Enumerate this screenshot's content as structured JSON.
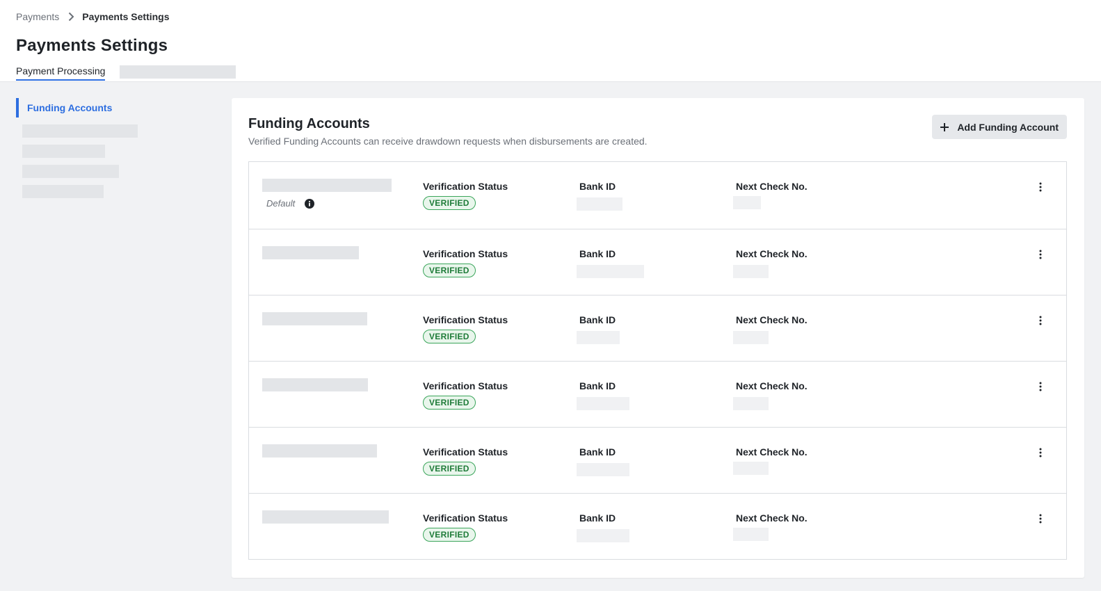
{
  "breadcrumb": {
    "parent": "Payments",
    "current": "Payments Settings"
  },
  "page": {
    "title": "Payments Settings"
  },
  "tabs": [
    {
      "label": "Payment Processing",
      "active": true
    }
  ],
  "sidenav": {
    "active_item": "Funding Accounts"
  },
  "funding": {
    "title": "Funding Accounts",
    "subtitle": "Verified Funding Accounts can receive drawdown requests when disbursements are created.",
    "add_button_label": "Add Funding Account",
    "default_label": "Default",
    "columns": {
      "status": "Verification Status",
      "bank": "Bank ID",
      "check": "Next Check No."
    },
    "accounts": [
      {
        "status": "VERIFIED",
        "is_default": true
      },
      {
        "status": "VERIFIED",
        "is_default": false
      },
      {
        "status": "VERIFIED",
        "is_default": false
      },
      {
        "status": "VERIFIED",
        "is_default": false
      },
      {
        "status": "VERIFIED",
        "is_default": false
      },
      {
        "status": "VERIFIED",
        "is_default": false
      }
    ]
  },
  "colors": {
    "accent": "#2d6ee0",
    "verified_text": "#1e7b38",
    "verified_border": "#3aa55a",
    "verified_bg": "#e9f6ec"
  },
  "icons": {
    "breadcrumb_separator": "chevron-right-icon",
    "add": "plus-icon",
    "info": "info-icon",
    "row_menu": "more-vertical-icon"
  }
}
